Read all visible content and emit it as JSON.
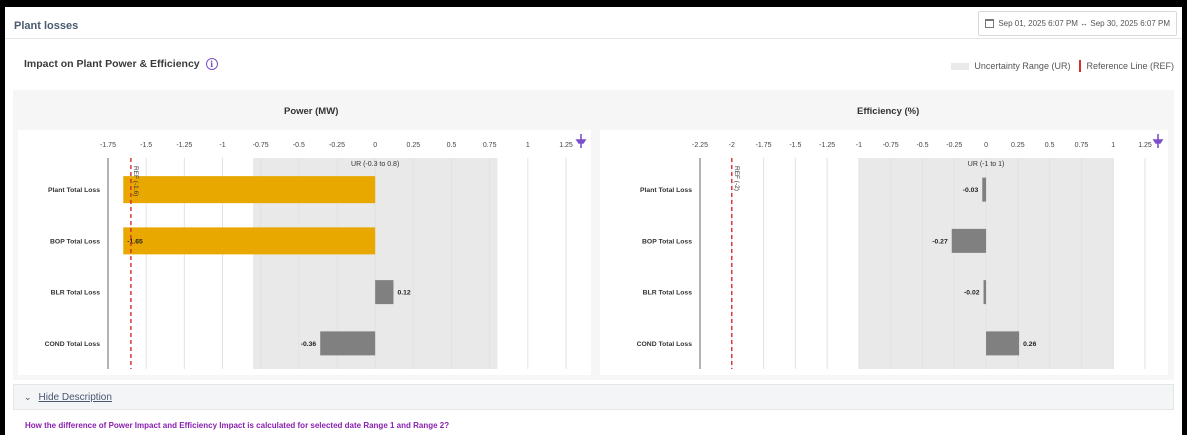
{
  "header": {
    "title": "Plant losses",
    "date_range": "Sep 01, 2025 6:07 PM ↔ Sep 30, 2025 6:07 PM"
  },
  "section": {
    "title": "Impact on Plant Power & Efficiency",
    "info_glyph": "i"
  },
  "legend": {
    "uncertainty_label": "Uncertainty Range (UR)",
    "reference_label": "Reference Line (REF)"
  },
  "description": {
    "toggle_label": "Hide Description",
    "question": "How the difference of Power Impact and Efficiency Impact is calculated for selected date Range 1 and Range 2?"
  },
  "colors": {
    "highlight": "#e8a800",
    "bar": "#808080",
    "ur_band": "#e9e9e9",
    "reference": "#d32f2f",
    "pin": "#7b4fc9"
  },
  "chart_data": [
    {
      "type": "bar",
      "orientation": "horizontal",
      "title": "Power (MW)",
      "categories": [
        "Plant Total Loss",
        "BOP Total Loss",
        "BLR Total Loss",
        "COND Total Loss"
      ],
      "values": [
        -1.65,
        -1.65,
        0.12,
        -0.36
      ],
      "value_labels": [
        "",
        "-1.65",
        "0.12",
        "-0.36"
      ],
      "highlighted": [
        true,
        true,
        false,
        false
      ],
      "xlim": [
        -1.75,
        1.25
      ],
      "xticks": [
        "-1.75",
        "-1.5",
        "-1.25",
        "-1",
        "-0.75",
        "-0.5",
        "-0.25",
        "0",
        "0.25",
        "0.5",
        "0.75",
        "1",
        "1.25"
      ],
      "uncertainty_range": [
        -0.8,
        0.8
      ],
      "ur_label": "UR (-0.3 to 0.8)",
      "reference": -1.6,
      "ref_label": "REF (-1.6)",
      "grid": true
    },
    {
      "type": "bar",
      "orientation": "horizontal",
      "title": "Efficiency (%)",
      "categories": [
        "Plant Total Loss",
        "BOP Total Loss",
        "BLR Total Loss",
        "COND Total Loss"
      ],
      "values": [
        -0.03,
        -0.27,
        -0.02,
        0.26
      ],
      "value_labels": [
        "-0.03",
        "-0.27",
        "-0.02",
        "0.26"
      ],
      "highlighted": [
        false,
        false,
        false,
        false
      ],
      "xlim": [
        -2.25,
        1.25
      ],
      "xticks": [
        "-2.25",
        "-2",
        "-1.75",
        "-1.5",
        "-1.25",
        "-1",
        "-0.75",
        "-0.5",
        "-0.25",
        "0",
        "0.25",
        "0.5",
        "0.75",
        "1",
        "1.25"
      ],
      "uncertainty_range": [
        -1,
        1
      ],
      "ur_label": "UR (-1 to 1)",
      "reference": -2,
      "ref_label": "REF (-2)",
      "grid": true
    }
  ]
}
